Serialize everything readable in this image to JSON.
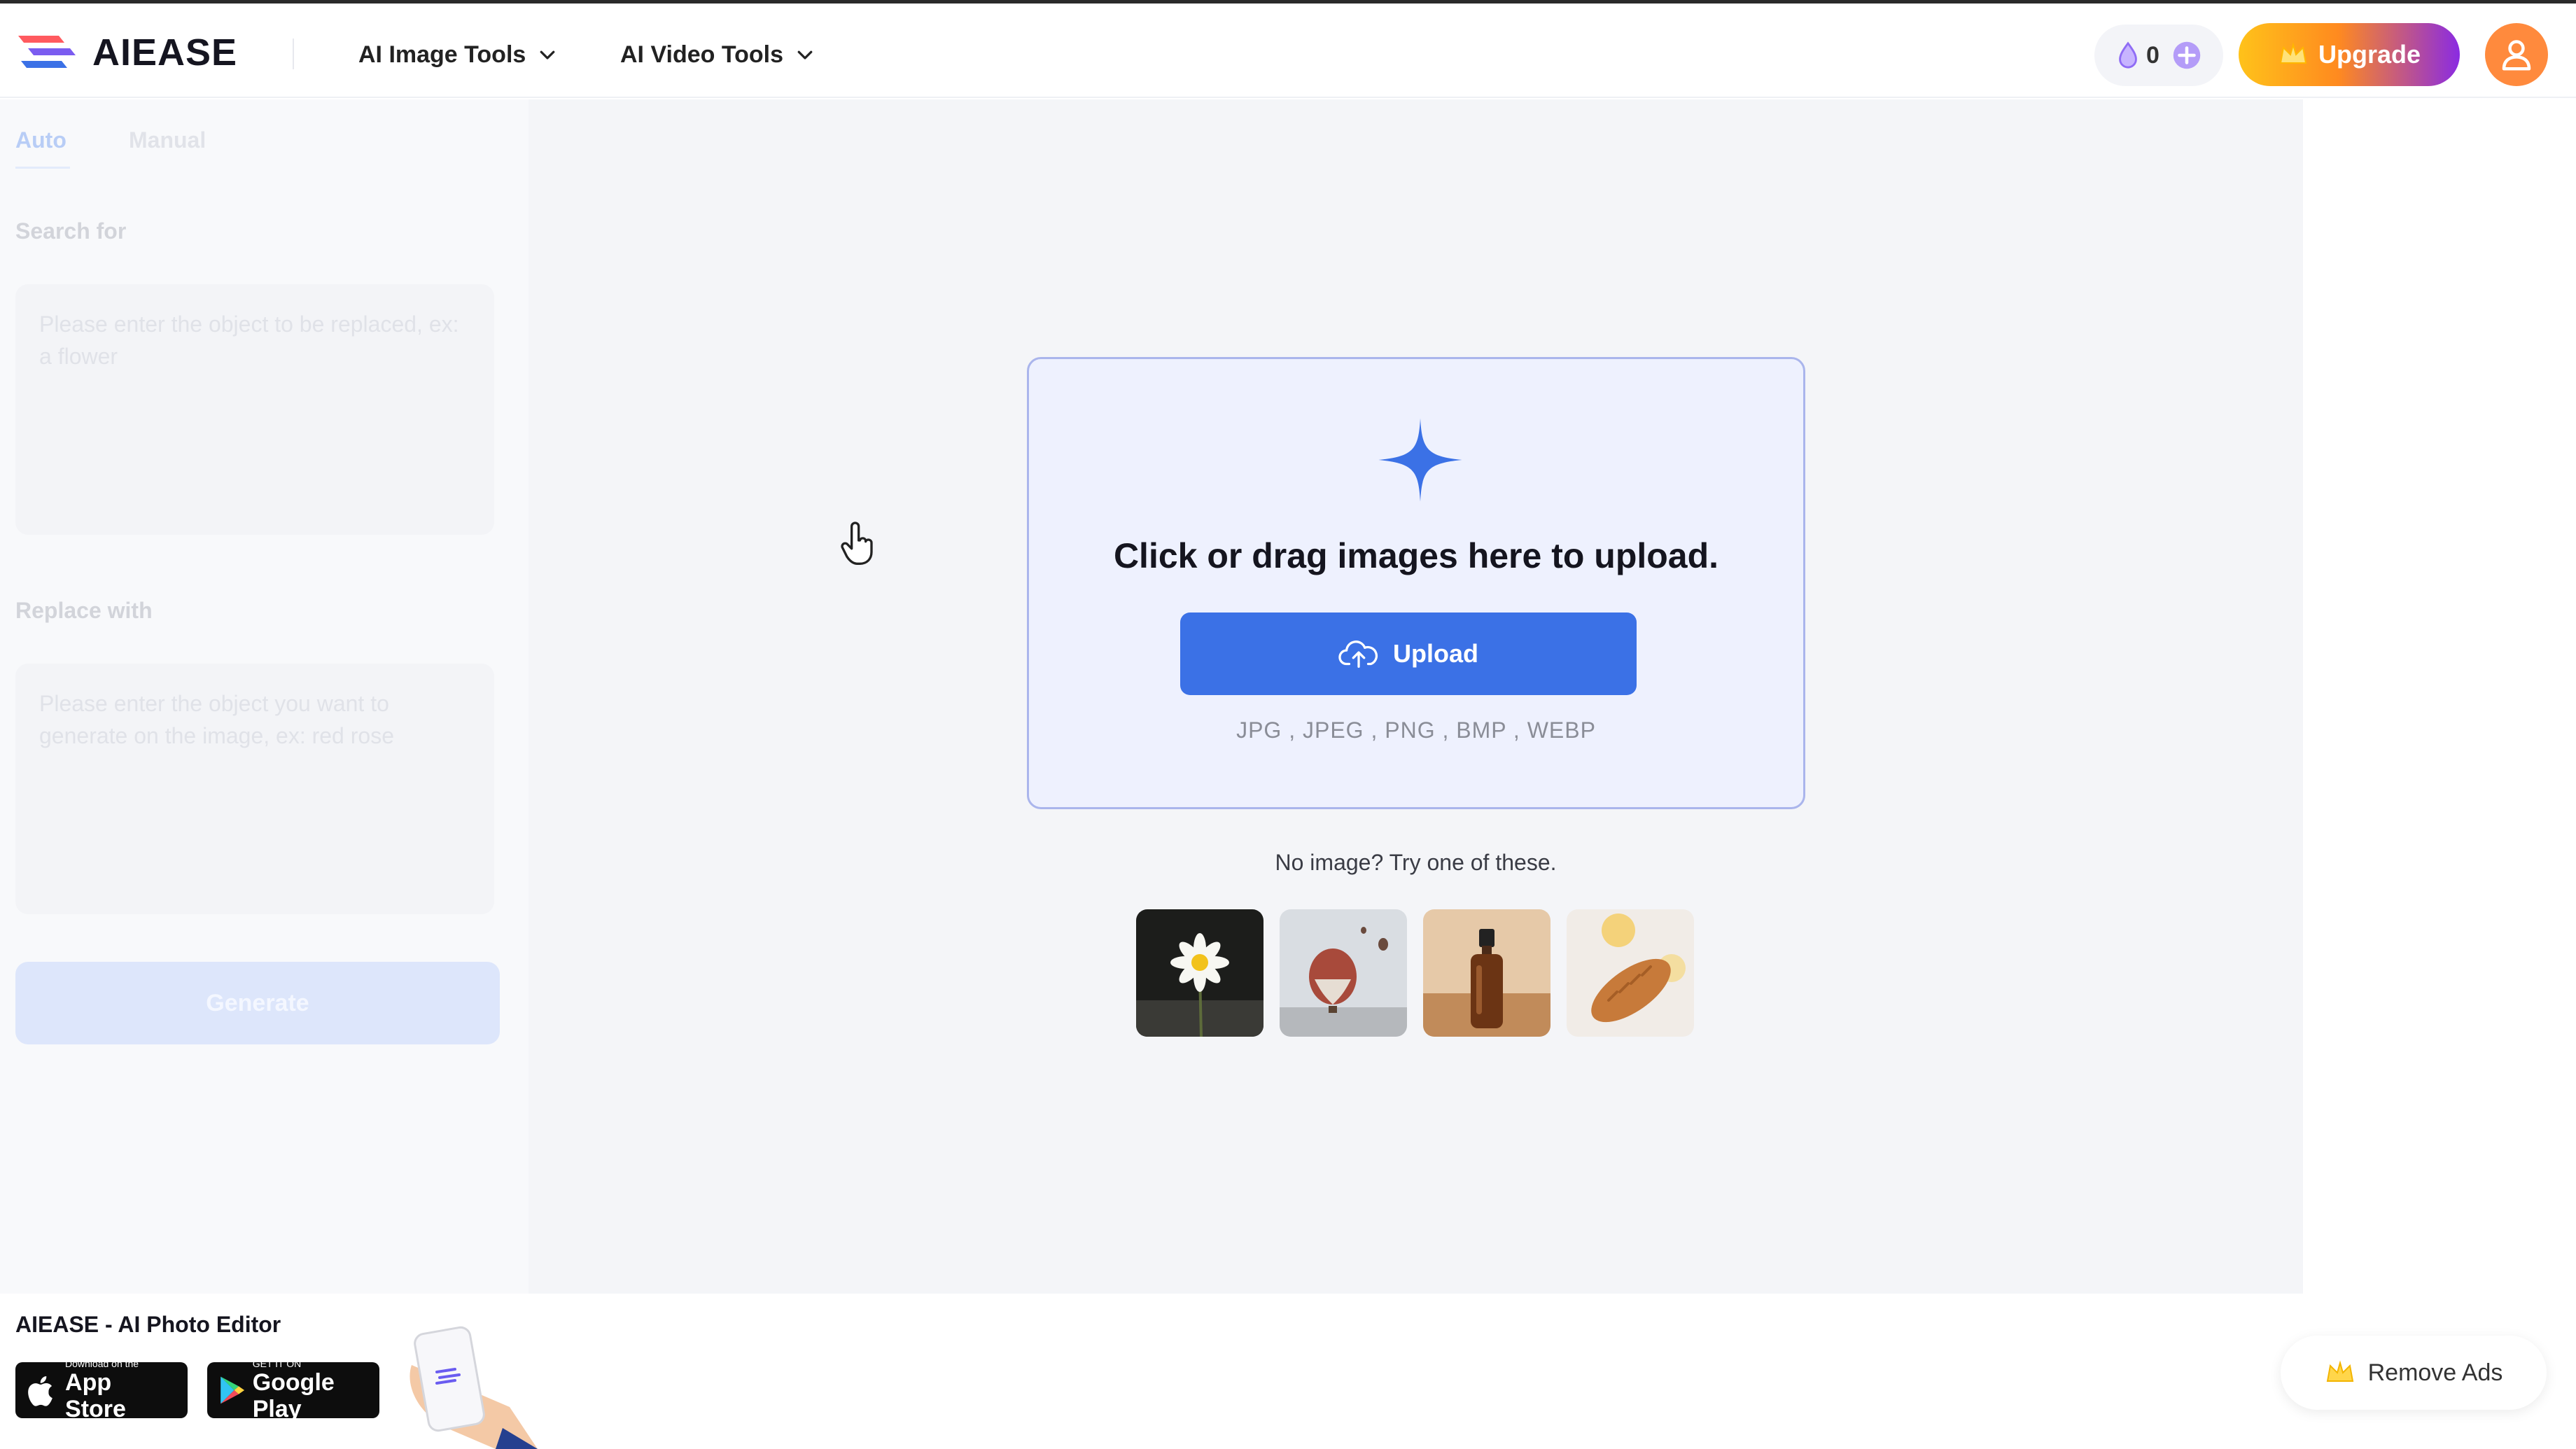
{
  "header": {
    "logo_text": "AIEASE",
    "nav": [
      {
        "label": "AI Image Tools"
      },
      {
        "label": "AI Video Tools"
      }
    ],
    "credits": "0",
    "upgrade_label": "Upgrade"
  },
  "sidebar": {
    "tabs": {
      "auto": "Auto",
      "manual": "Manual"
    },
    "search_label": "Search for",
    "search_placeholder": "Please enter the object to be replaced, ex: a flower",
    "replace_label": "Replace with",
    "replace_placeholder": "Please enter the object you want to generate on the image, ex: red rose",
    "generate_label": "Generate"
  },
  "upload": {
    "title": "Click or drag images here to upload.",
    "button_label": "Upload",
    "formats": "JPG , JPEG , PNG , BMP , WEBP",
    "try_text": "No image? Try one of these."
  },
  "footer": {
    "app_title": "AIEASE - AI Photo Editor",
    "app_store": {
      "small": "Download on the",
      "big": "App Store"
    },
    "google_play": {
      "small": "GET IT ON",
      "big": "Google Play"
    },
    "remove_ads_label": "Remove Ads"
  },
  "colors": {
    "primary": "#3b71e6",
    "upgrade_start": "#ffc21a",
    "upgrade_end": "#8a2be2",
    "avatar": "#ff8a3d"
  }
}
